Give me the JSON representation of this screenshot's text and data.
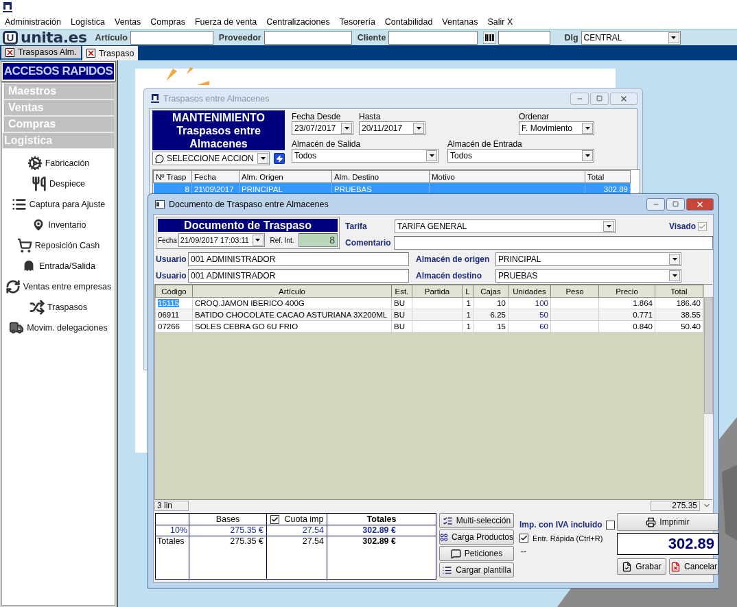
{
  "menu": [
    "Administración",
    "Logística",
    "Ventas",
    "Compras",
    "Fuerza de venta",
    "Centralizaciones",
    "Tesorería",
    "Contabilidad",
    "Ventanas",
    "Salir X"
  ],
  "toolbar": {
    "logo_mark": "U",
    "logo_text": "unita.es",
    "search_fields": [
      {
        "label": "Artículo"
      },
      {
        "label": "Proveedor"
      },
      {
        "label": "Cliente"
      }
    ],
    "delegation": {
      "label": "Dlg",
      "value": "CENTRAL"
    }
  },
  "tabs": [
    {
      "label": "Traspasos Alm.",
      "selected": false
    },
    {
      "label": "Traspaso",
      "selected": true
    }
  ],
  "sidebar": {
    "title": "ACCESOS RAPIDOS",
    "sections": [
      {
        "label": "Maestros",
        "expanded": false
      },
      {
        "label": "Ventas",
        "expanded": false
      },
      {
        "label": "Compras",
        "expanded": false
      },
      {
        "label": "Logística",
        "expanded": true
      }
    ],
    "items": [
      {
        "label": "Fabricación"
      },
      {
        "label": "Despiece"
      },
      {
        "label": "Captura para Ajuste"
      },
      {
        "label": "Inventario"
      },
      {
        "label": "Reposición Cash"
      },
      {
        "label": "Entrada/Salida"
      },
      {
        "label": "Ventas entre empresas"
      },
      {
        "label": "Traspasos"
      },
      {
        "label": "Movim. delegaciones"
      }
    ]
  },
  "list_window": {
    "title": "Traspasos entre Almacenes",
    "banner_title": "MANTENIMIENTO",
    "banner_subtitle": "Traspasos entre Almacenes",
    "action": "SELECCIONE ACCION",
    "fecha_desde": {
      "label": "Fecha Desde",
      "value": "23/07/2017"
    },
    "hasta": {
      "label": "Hasta",
      "value": "20/11/2017"
    },
    "ordenar": {
      "label": "Ordenar",
      "value": "F. Movimiento"
    },
    "almacen_salida": {
      "label": "Almacén de Salida",
      "value": "Todos"
    },
    "almacen_entrada": {
      "label": "Almacén de Entrada",
      "value": "Todos"
    },
    "columns": [
      "Nº Trasp",
      "Fecha",
      "Alm. Origen",
      "Alm. Destino",
      "Motivo",
      "Total"
    ],
    "rows": [
      {
        "numero": "8",
        "fecha": "21\\09\\2017",
        "origen": "PRINCIPAL",
        "destino": "PRUEBAS",
        "total": "302.89",
        "selected": true
      }
    ]
  },
  "document_window": {
    "title": "Documento de Traspaso entre Almacenes",
    "banner": "Documento de Traspaso",
    "fecha": {
      "label": "Fecha",
      "value": "21/09/2017 17:03:11"
    },
    "ref": {
      "label": "Ref. Int.",
      "value": "8"
    },
    "tarifa": {
      "label": "Tarifa",
      "value": "TARIFA GENERAL"
    },
    "visado": {
      "label": "Visado",
      "checked": true
    },
    "comentario": {
      "label": "Comentario"
    },
    "usuarios": [
      {
        "label": "Usuario",
        "value": "001 ADMINISTRADOR"
      },
      {
        "label": "Usuario",
        "value": "001 ADMINISTRADOR"
      }
    ],
    "almacen_origen": {
      "label": "Almacén de origen",
      "value": "PRINCIPAL"
    },
    "almacen_destino": {
      "label": "Almacén destino",
      "value": "PRUEBAS"
    },
    "columns": [
      "Código",
      "Artículo",
      "Est.",
      "Partida",
      "L",
      "Cajas",
      "Unidades",
      "Peso",
      "Precio",
      "Total"
    ],
    "rows": [
      {
        "codigo": "15115",
        "articulo": "CROQ.JAMON IBERICO 400G",
        "est": "BU",
        "l": "1",
        "cajas": "10",
        "unidades": "100",
        "precio": "1.864",
        "total": "186.40",
        "selected": true
      },
      {
        "codigo": "06911",
        "articulo": "BATIDO CHOCOLATE CACAO ASTURIANA 3X200ML",
        "est": "BU",
        "l": "1",
        "cajas": "6.25",
        "unidades": "50",
        "precio": "0.771",
        "total": "38.55",
        "selected": false
      },
      {
        "codigo": "07266",
        "articulo": "SOLES CEBRA GO 6U FRIO",
        "est": "BU",
        "l": "1",
        "cajas": "15",
        "unidades": "60",
        "precio": "0.840",
        "total": "50.40",
        "selected": false
      }
    ],
    "line_count": "3 lin",
    "grid_sum": "275.35",
    "totals": {
      "bases_label": "Bases",
      "cuota": {
        "label": "Cuota imp",
        "checked": true
      },
      "totales_label": "Totales",
      "rows": [
        {
          "kind": "rate",
          "label": "10%",
          "bases": "275.35 €",
          "cuota": "27.54",
          "totales": "302.89 €"
        },
        {
          "kind": "sum",
          "label": "Totales",
          "bases": "275.35 €",
          "cuota": "27.54",
          "totales": "302.89 €"
        }
      ]
    },
    "actions": [
      "Multi-selección",
      "Carga Productos",
      "Peticiones",
      "Cargar plantilla"
    ],
    "iva_incluido": {
      "label": "Imp. con IVA incluido",
      "checked": false
    },
    "entrada_rapida": {
      "label": "Entr. Rápida (Ctrl+R)",
      "checked": true
    },
    "note": "--",
    "print_button": "Imprimir",
    "total": "302.89",
    "save_button": "Grabar",
    "cancel_button": "Cancelar"
  }
}
